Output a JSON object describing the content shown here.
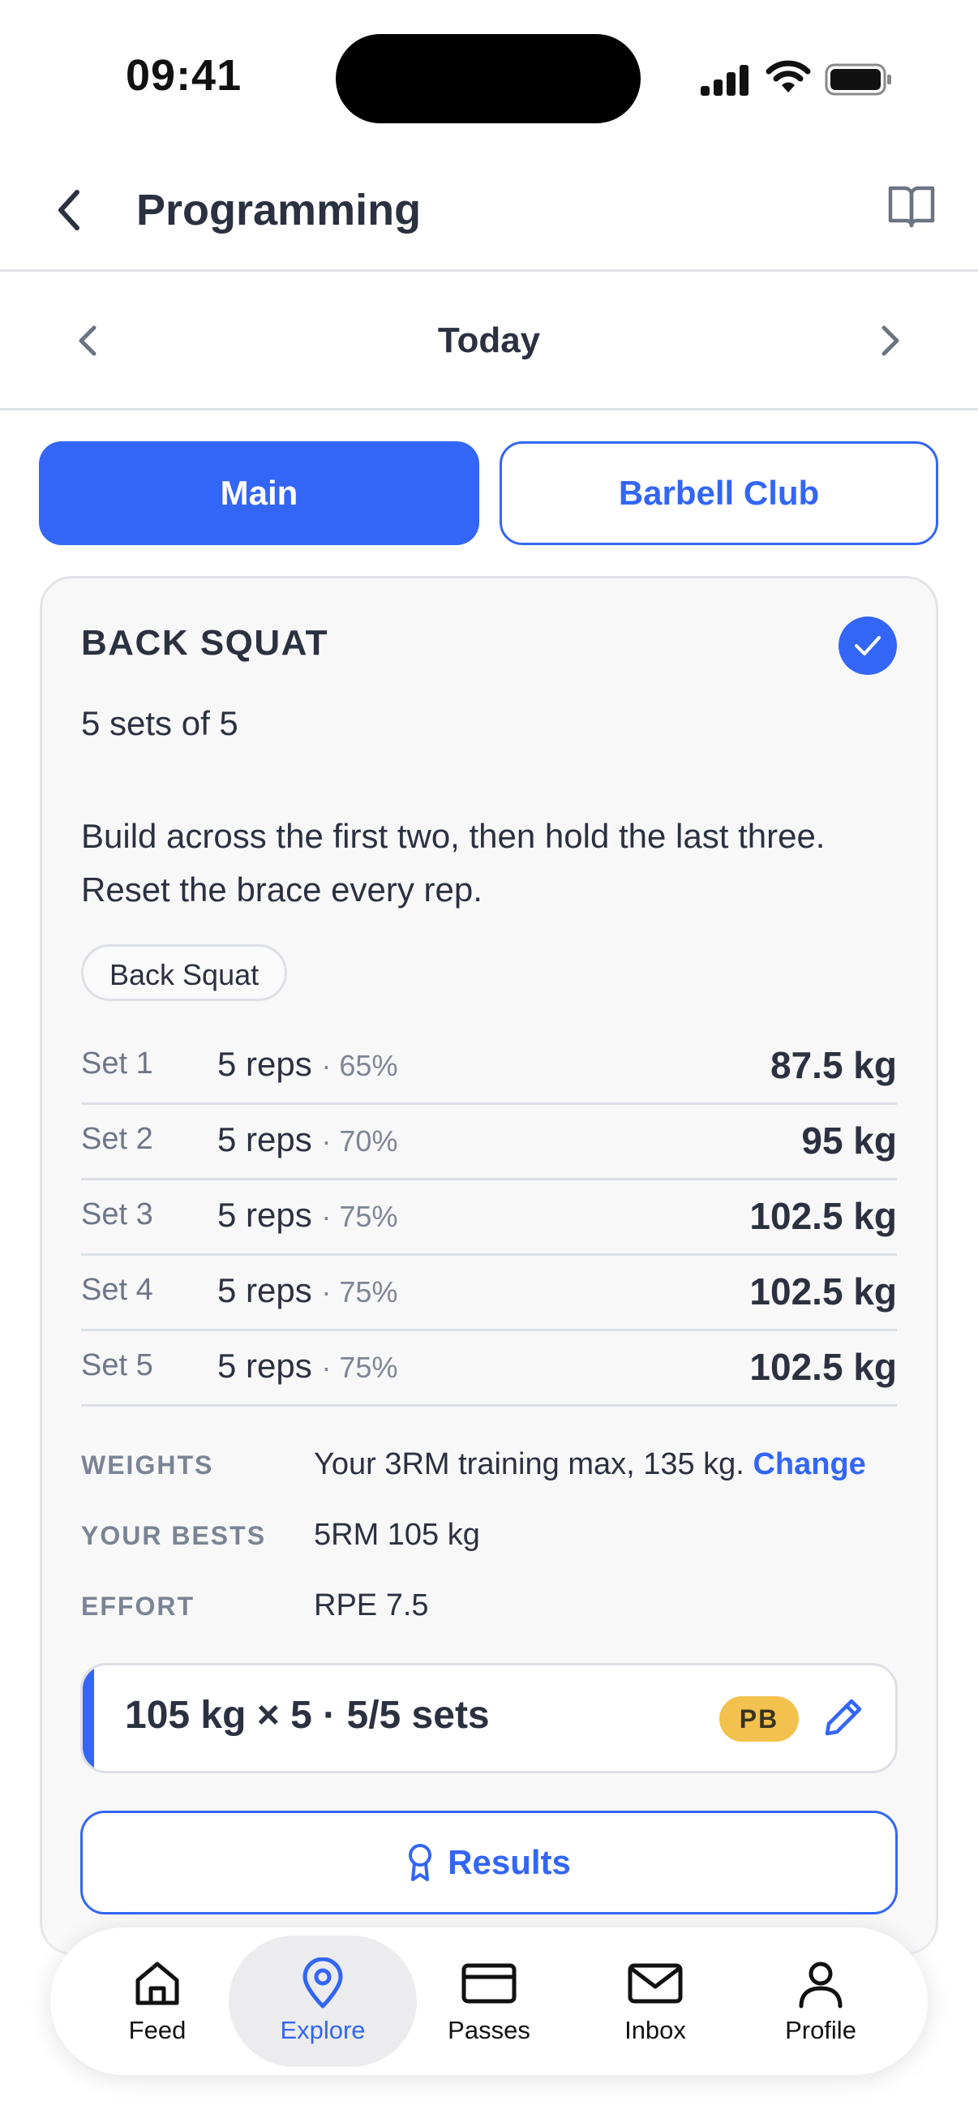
{
  "status_bar": {
    "time": "09:41"
  },
  "header": {
    "title": "Programming"
  },
  "day_nav": {
    "label": "Today"
  },
  "tabs": [
    {
      "label": "Main",
      "active": true
    },
    {
      "label": "Barbell Club",
      "active": false
    }
  ],
  "workout": {
    "title": "BACK SQUAT",
    "completed": true,
    "scheme": "5 sets of 5",
    "note": "Build across the first two, then hold the last three. Reset the brace every rep.",
    "tag": "Back Squat",
    "sets": [
      {
        "name": "Set 1",
        "reps": "5 reps",
        "pct": "· 65%",
        "weight": "87.5 kg"
      },
      {
        "name": "Set 2",
        "reps": "5 reps",
        "pct": "· 70%",
        "weight": "95 kg"
      },
      {
        "name": "Set 3",
        "reps": "5 reps",
        "pct": "· 75%",
        "weight": "102.5 kg"
      },
      {
        "name": "Set 4",
        "reps": "5 reps",
        "pct": "· 75%",
        "weight": "102.5 kg"
      },
      {
        "name": "Set 5",
        "reps": "5 reps",
        "pct": "· 75%",
        "weight": "102.5 kg"
      }
    ],
    "meta": {
      "weights_label": "WEIGHTS",
      "weights_value": "Your 3RM training max, 135 kg.",
      "weights_action": "Change",
      "bests_label": "YOUR BESTS",
      "bests_value": "5RM 105 kg",
      "effort_label": "EFFORT",
      "effort_value": "RPE 7.5"
    },
    "result": {
      "text": "105 kg × 5 · 5/5 sets",
      "badge": "PB"
    },
    "results_button": "Results"
  },
  "bottom_nav": [
    {
      "label": "Feed",
      "icon": "home-icon",
      "active": false
    },
    {
      "label": "Explore",
      "icon": "map-pin-icon",
      "active": true
    },
    {
      "label": "Passes",
      "icon": "card-icon",
      "active": false
    },
    {
      "label": "Inbox",
      "icon": "mail-icon",
      "active": false
    },
    {
      "label": "Profile",
      "icon": "user-icon",
      "active": false
    }
  ],
  "colors": {
    "accent": "#3366f6",
    "badge": "#f2c14e",
    "text": "#2b3140"
  }
}
